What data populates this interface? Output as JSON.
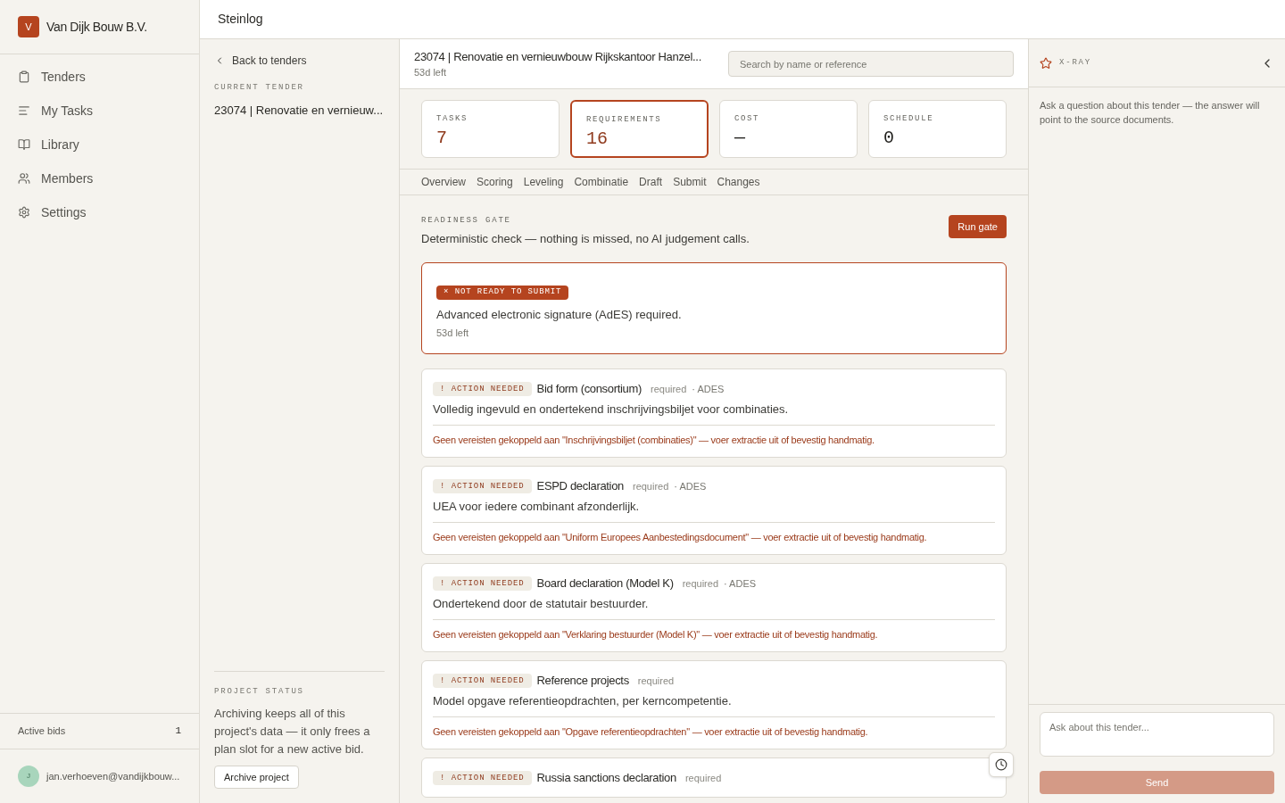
{
  "org": {
    "initial": "V",
    "name": "Van Dijk Bouw B.V."
  },
  "nav": [
    {
      "label": "Tenders",
      "selected": false
    },
    {
      "label": "My Tasks",
      "selected": false
    },
    {
      "label": "Library",
      "selected": false
    },
    {
      "label": "Members",
      "selected": false
    },
    {
      "label": "Settings",
      "selected": false
    }
  ],
  "active_bids": {
    "label": "Active bids",
    "count": "1"
  },
  "user": {
    "initial": "J",
    "email": "jan.verhoeven@vandijkbouw..."
  },
  "topbar": {
    "title": "Steinlog"
  },
  "tender_nav": {
    "back": "Back to tenders",
    "current_label": "CURRENT TENDER",
    "current": "23074 | Renovatie en vernieuw...",
    "status_label": "PROJECT STATUS",
    "status_text": "Archiving keeps all of this project's data — it only frees a plan slot for a new active bid.",
    "archive_button": "Archive project"
  },
  "tender": {
    "title": "23074 | Renovatie en vernieuwbouw Rijkskantoor Hanzel...",
    "deadline": "53d left"
  },
  "search": {
    "placeholder": "Search by name or reference"
  },
  "stats": [
    {
      "label": "TASKS",
      "value": "7",
      "selected": false,
      "accent": true
    },
    {
      "label": "REQUIREMENTS",
      "value": "16",
      "selected": true,
      "accent": true
    },
    {
      "label": "COST",
      "value": "—",
      "selected": false,
      "accent": false
    },
    {
      "label": "SCHEDULE",
      "value": "0",
      "selected": false,
      "accent": false
    }
  ],
  "tabs": [
    {
      "label": "Overview",
      "selected": false
    },
    {
      "label": "Scoring",
      "selected": false
    },
    {
      "label": "Leveling",
      "selected": false
    },
    {
      "label": "Combinatie",
      "selected": false
    },
    {
      "label": "Draft",
      "selected": false
    },
    {
      "label": "Submit",
      "selected": false
    },
    {
      "label": "Changes",
      "selected": false
    }
  ],
  "gate": {
    "label": "READINESS GATE",
    "description": "Deterministic check — nothing is missed, no AI judgement calls.",
    "button": "Run gate",
    "status_icon": "×",
    "status": "NOT READY TO SUBMIT",
    "message": "Advanced electronic signature (AdES) required.",
    "deadline": "53d left"
  },
  "requirements": [
    {
      "badge_icon": "!",
      "badge": "ACTION NEEDED",
      "title": "Bid form (consortium)",
      "required": "required",
      "tag": "· ADES",
      "description": "Volledig ingevuld en ondertekend inschrijvingsbiljet voor combinaties.",
      "warning": "Geen vereisten gekoppeld aan \"Inschrijvingsbiljet (combinaties)\" — voer extractie uit of bevestig handmatig."
    },
    {
      "badge_icon": "!",
      "badge": "ACTION NEEDED",
      "title": "ESPD declaration",
      "required": "required",
      "tag": "· ADES",
      "description": "UEA voor iedere combinant afzonderlijk.",
      "warning": "Geen vereisten gekoppeld aan \"Uniform Europees Aanbestedingsdocument\" — voer extractie uit of bevestig handmatig."
    },
    {
      "badge_icon": "!",
      "badge": "ACTION NEEDED",
      "title": "Board declaration (Model K)",
      "required": "required",
      "tag": "· ADES",
      "description": "Ondertekend door de statutair bestuurder.",
      "warning": "Geen vereisten gekoppeld aan \"Verklaring bestuurder (Model K)\" — voer extractie uit of bevestig handmatig."
    },
    {
      "badge_icon": "!",
      "badge": "ACTION NEEDED",
      "title": "Reference projects",
      "required": "required",
      "description": "Model opgave referentieopdrachten, per kerncompetentie.",
      "warning": "Geen vereisten gekoppeld aan \"Opgave referentieopdrachten\" — voer extractie uit of bevestig handmatig."
    },
    {
      "badge_icon": "!",
      "badge": "ACTION NEEDED",
      "title": "Russia sanctions declaration",
      "required": "required"
    }
  ],
  "xray": {
    "title": "X-RAY",
    "intro": "Ask a question about this tender — the answer will point to the source documents.",
    "placeholder": "Ask about this tender...",
    "send": "Send",
    "send_disabled": true
  }
}
